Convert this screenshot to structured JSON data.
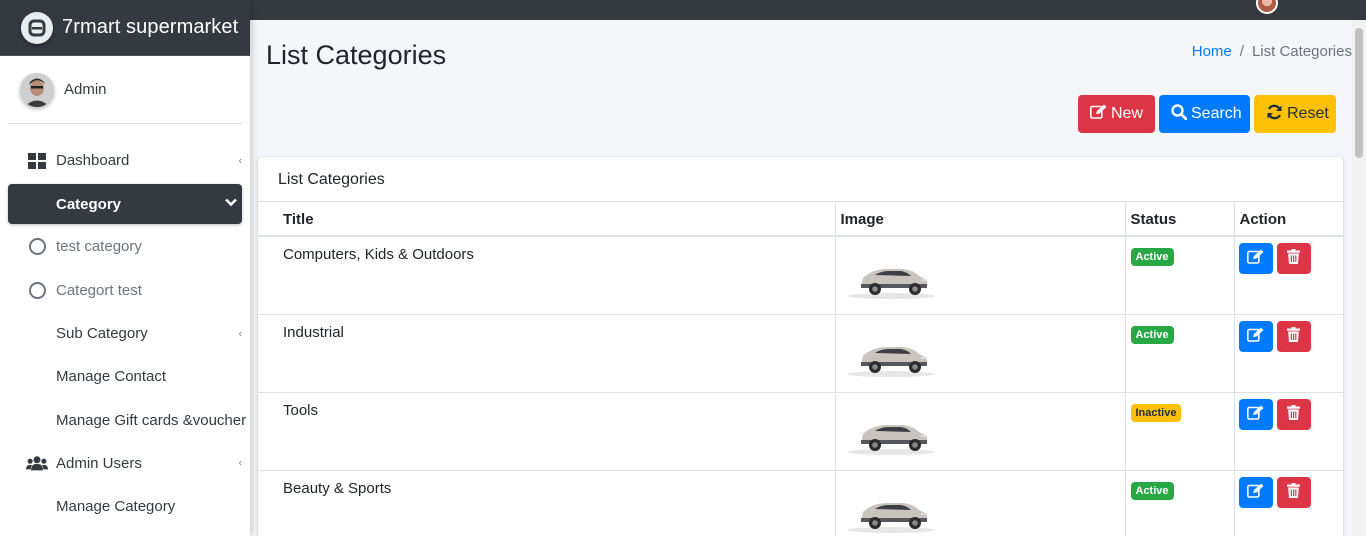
{
  "brand": {
    "name": "7rmart supermarket"
  },
  "user": {
    "name": "Admin"
  },
  "sidebar": {
    "items": [
      {
        "label": "Dashboard"
      },
      {
        "label": "Category"
      },
      {
        "label": "test category"
      },
      {
        "label": "Categort test"
      },
      {
        "label": "Sub Category"
      },
      {
        "label": "Manage Contact"
      },
      {
        "label": "Manage Gift cards &voucher"
      },
      {
        "label": "Admin Users"
      },
      {
        "label": "Manage Category"
      }
    ]
  },
  "page": {
    "title": "List Categories"
  },
  "breadcrumb": {
    "home": "Home",
    "separator": "/",
    "current": "List Categories"
  },
  "toolbar": {
    "new_label": "New",
    "search_label": "Search",
    "reset_label": "Reset"
  },
  "card": {
    "title": "List Categories"
  },
  "table": {
    "headers": {
      "title": "Title",
      "image": "Image",
      "status": "Status",
      "action": "Action"
    },
    "rows": [
      {
        "title": "Computers, Kids & Outdoors",
        "status": "Active"
      },
      {
        "title": "Industrial",
        "status": "Active"
      },
      {
        "title": "Tools",
        "status": "Inactive"
      },
      {
        "title": "Beauty & Sports",
        "status": "Active"
      }
    ]
  },
  "colors": {
    "sidebar_dark": "#343a40",
    "primary": "#007bff",
    "danger": "#dc3545",
    "warning": "#ffc107",
    "success": "#28a745"
  }
}
